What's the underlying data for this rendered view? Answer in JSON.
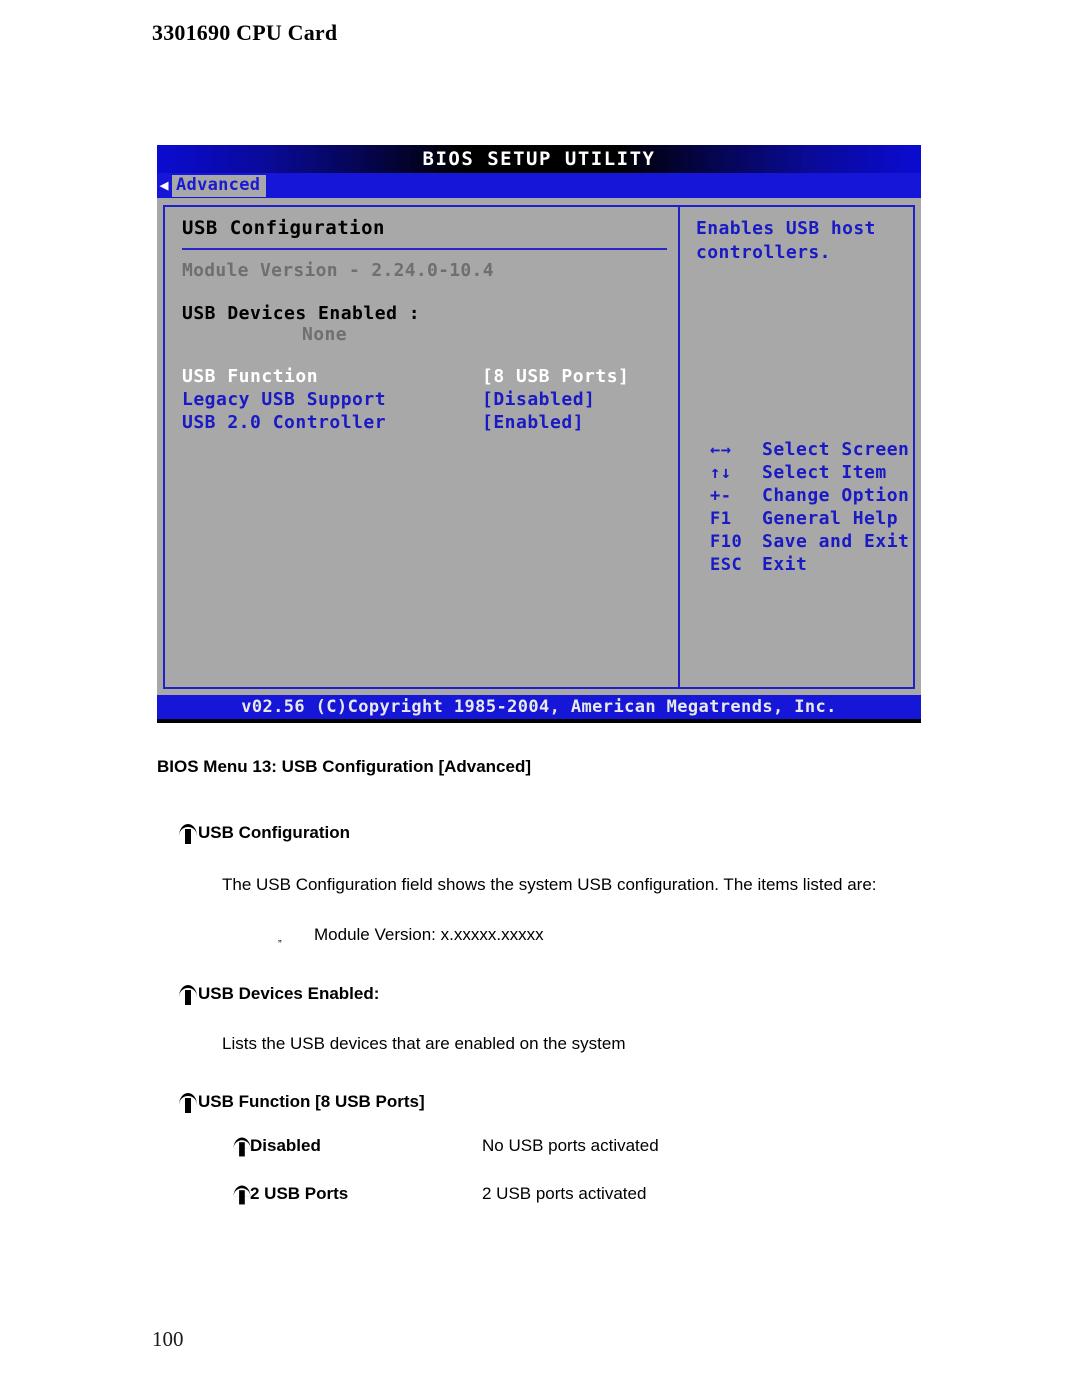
{
  "page": {
    "header_title": "3301690 CPU Card",
    "page_number": "100"
  },
  "bios": {
    "title": "BIOS SETUP UTILITY",
    "tab_arrow_icon": "left-triangle-icon",
    "active_tab": "Advanced",
    "section_title": "USB Configuration",
    "module_version": "Module Version - 2.24.0-10.4",
    "devices_enabled_label": "USB Devices Enabled :",
    "devices_enabled_value": "None",
    "options": [
      {
        "label": "USB Function",
        "value": "[8 USB Ports]",
        "selected": true
      },
      {
        "label": "Legacy USB Support",
        "value": "[Disabled]",
        "selected": false
      },
      {
        "label": "USB 2.0 Controller",
        "value": "[Enabled]",
        "selected": false
      }
    ],
    "help_text": "Enables USB host controllers.",
    "keys": [
      {
        "sym": "←→",
        "desc": "Select Screen"
      },
      {
        "sym": "↑↓",
        "desc": "Select Item"
      },
      {
        "sym": "+-",
        "desc": "Change Option"
      },
      {
        "sym": "F1",
        "desc": "General Help"
      },
      {
        "sym": "F10",
        "desc": "Save and Exit"
      },
      {
        "sym": "ESC",
        "desc": "Exit"
      }
    ],
    "footer": "v02.56 (C)Copyright 1985-2004, American Megatrends, Inc.",
    "colors": {
      "panel_bg": "#a8a8a8",
      "accent_blue": "#1a1ac4",
      "title_bar_blue": "#0b0bd2",
      "dim_text": "#6f6f6f",
      "selected_text": "#ffffff"
    }
  },
  "doc": {
    "caption": "BIOS Menu 13: USB Configuration [Advanced]",
    "item_usb_config": "USB Configuration",
    "para_usb_config": "The USB Configuration field shows the system USB configuration. The items listed are:",
    "sub_module_version": "Module Version: x.xxxxx.xxxxx",
    "item_devices_enabled": "USB Devices Enabled:",
    "para_devices_enabled": "Lists the USB devices that are enabled on the system",
    "item_usb_function": "USB Function [8 USB Ports]",
    "options": [
      {
        "term": "Disabled",
        "definition": "No USB ports activated"
      },
      {
        "term": "2 USB Ports",
        "definition": "2 USB ports activated"
      }
    ]
  }
}
